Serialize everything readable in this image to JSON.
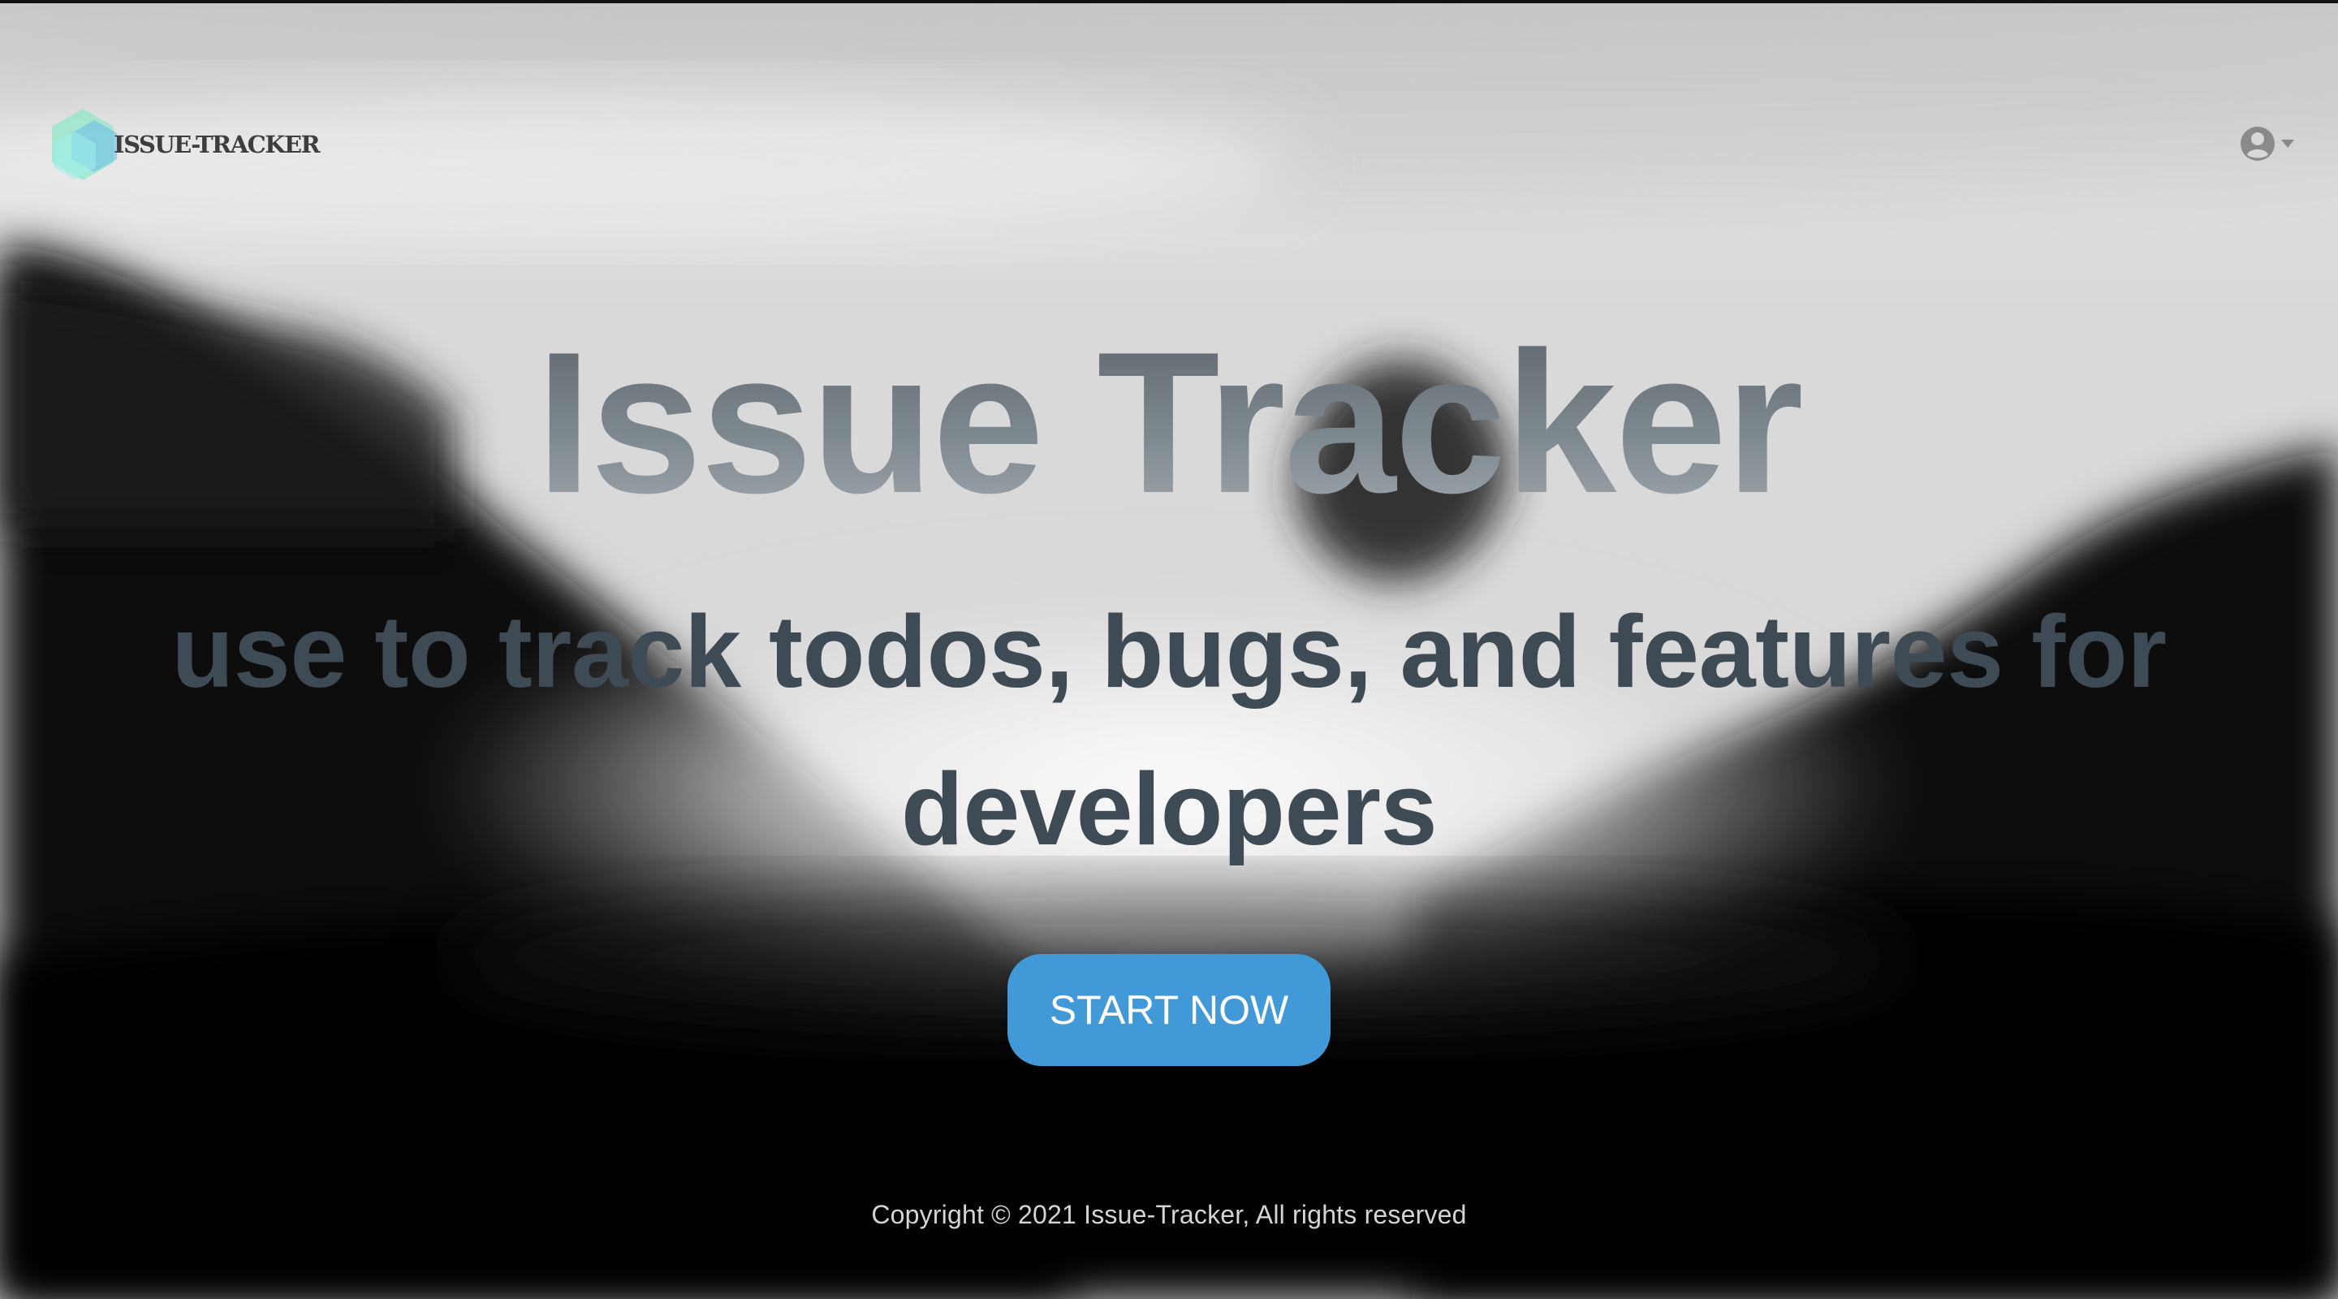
{
  "brand": {
    "name": "ISSUE-TRACKER",
    "logo_icon": "hexagon-logo-icon"
  },
  "navbar": {
    "user_icon": "user-circle-icon",
    "caret_icon": "chevron-down-icon"
  },
  "hero": {
    "title": "Issue Tracker",
    "subtitle": "use to track todos, bugs, and features for developers",
    "cta_label": "START NOW"
  },
  "footer": {
    "copyright": "Copyright © 2021 Issue-Tracker, All rights reserved"
  },
  "colors": {
    "cta_background": "#4299d8",
    "title_gray": "#7f8991",
    "subtitle_slate": "#3e4a54",
    "logo_aqua": "#7fe3d0"
  }
}
